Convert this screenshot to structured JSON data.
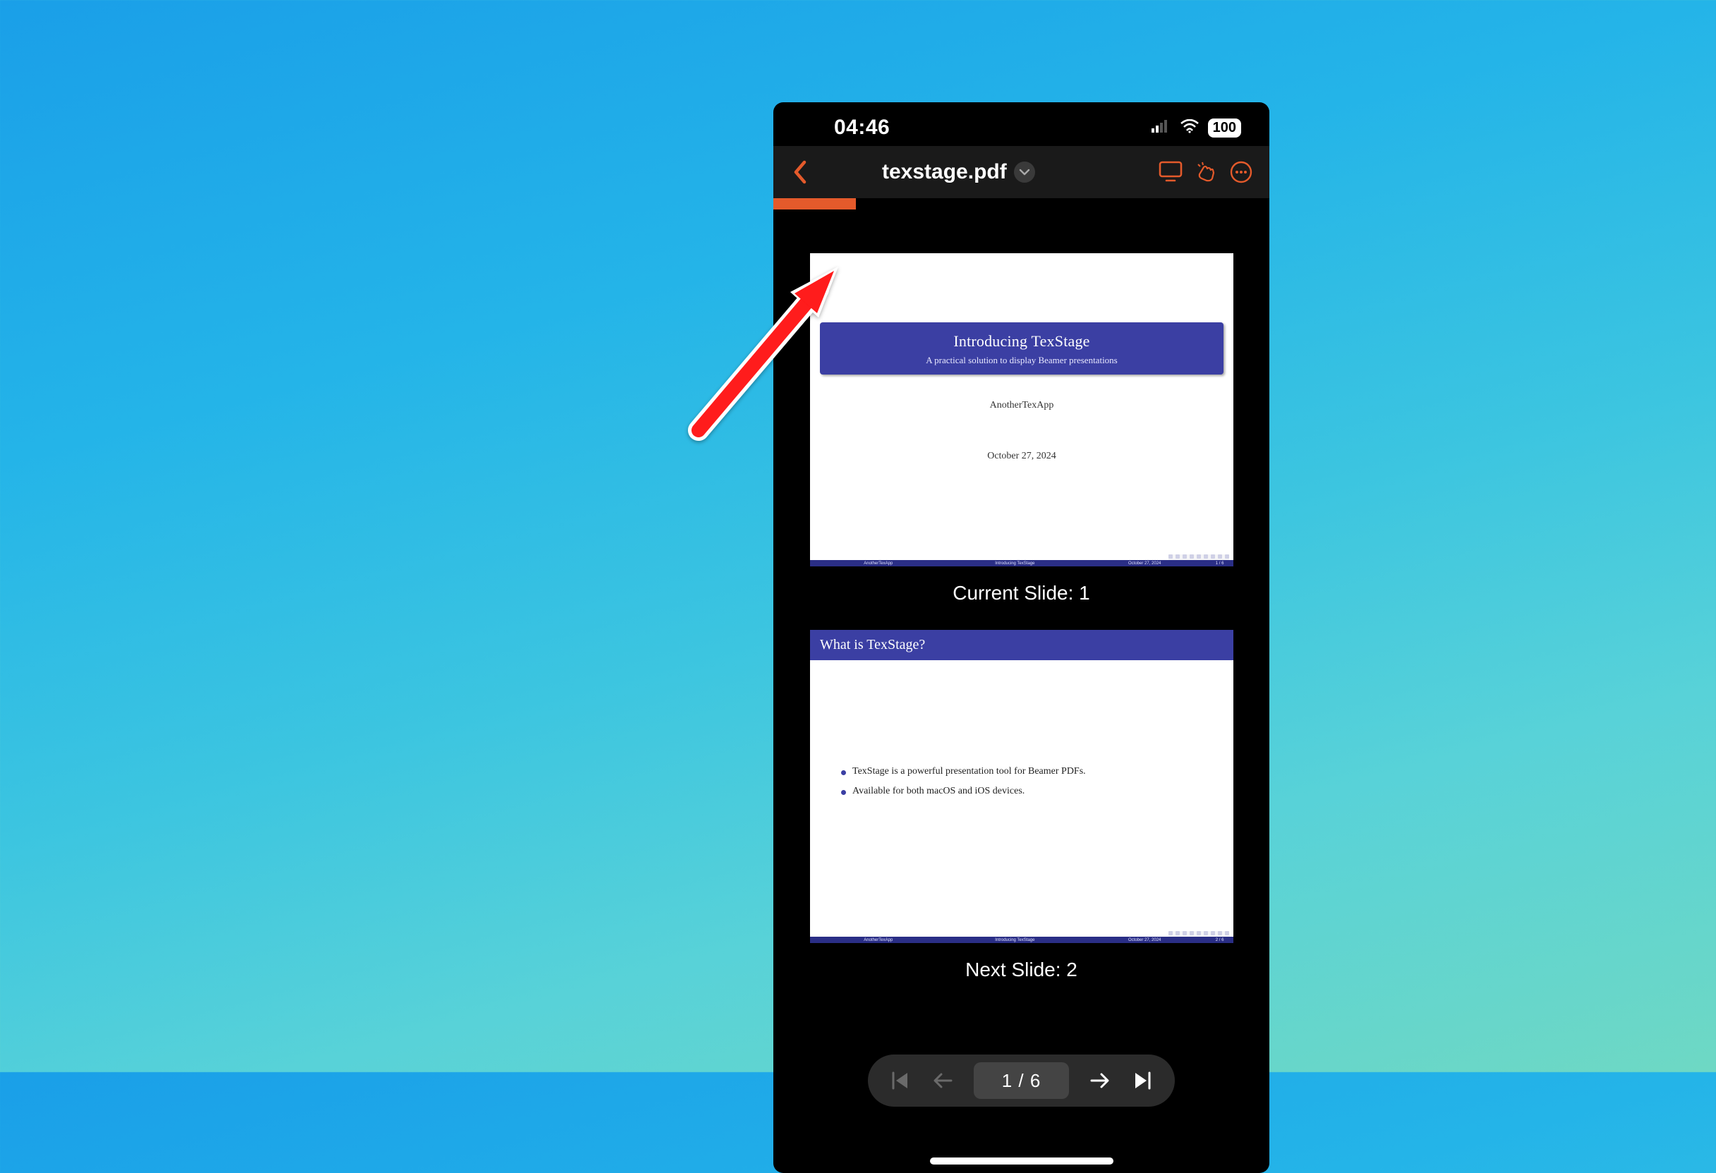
{
  "statusbar": {
    "time": "04:46",
    "battery": "100"
  },
  "nav": {
    "title": "texstage.pdf"
  },
  "progress": {
    "percent": 16.7
  },
  "slide1": {
    "title": "Introducing TexStage",
    "subtitle": "A practical solution to display Beamer presentations",
    "author": "AnotherTexApp",
    "date": "October 27, 2024",
    "footer_left": "AnotherTexApp",
    "footer_mid": "Introducing TexStage",
    "footer_right": "October 27, 2024",
    "footer_page": "1 / 6",
    "caption": "Current Slide: 1"
  },
  "slide2": {
    "header": "What is TexStage?",
    "bullet1": "TexStage is a powerful presentation tool for Beamer PDFs.",
    "bullet2": "Available for both macOS and iOS devices.",
    "footer_left": "AnotherTexApp",
    "footer_mid": "Introducing TexStage",
    "footer_right": "October 27, 2024",
    "footer_page": "2 / 6",
    "caption": "Next Slide: 2"
  },
  "controls": {
    "page_indicator": "1 / 6"
  }
}
